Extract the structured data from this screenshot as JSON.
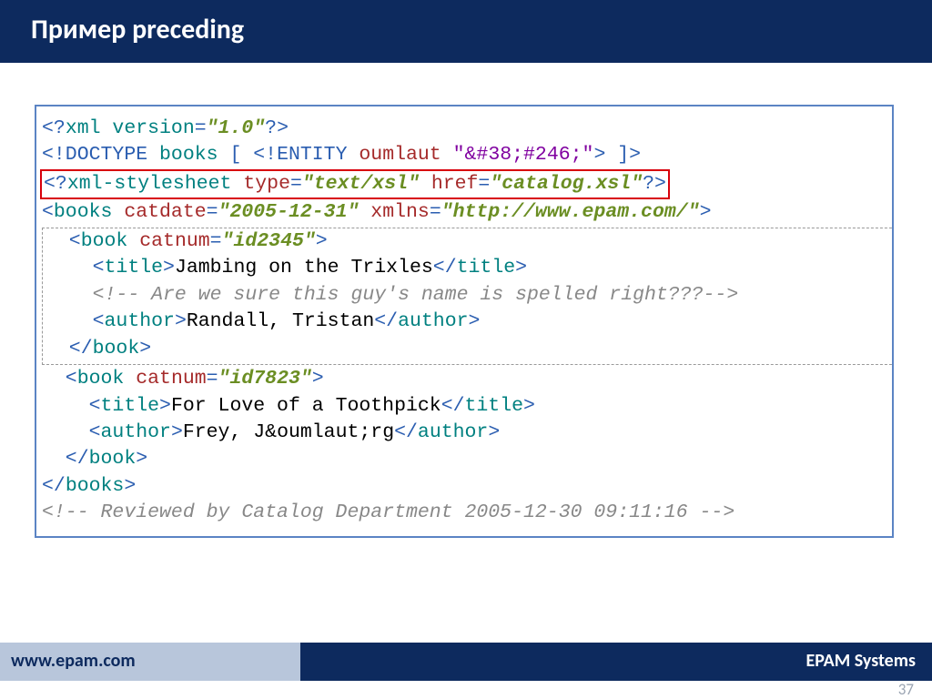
{
  "title": "Пример preceding",
  "code": {
    "l1": {
      "a": "<?",
      "b": "xml version",
      "c": "=",
      "d": "\"1.0\"",
      "e": "?>"
    },
    "l2": {
      "a": "<!DOCTYPE ",
      "b": "books",
      "c": " [ ",
      "d": "<!ENTITY ",
      "e": "oumlaut ",
      "f": "\"&#38;#246;\"",
      "g": "> ",
      "h": "]>"
    },
    "l3": {
      "a": "<?",
      "b": "xml-stylesheet ",
      "c": "type",
      "d": "=",
      "e": "\"text/xsl\" ",
      "f": "href",
      "g": "=",
      "h": "\"catalog.xsl\"",
      "i": "?>"
    },
    "l4": {
      "a": "<",
      "b": "books ",
      "c": "catdate",
      "d": "=",
      "e": "\"2005-12-31\" ",
      "f": "xmlns",
      "g": "=",
      "h": "\"http://www.epam.com/\"",
      "i": ">"
    },
    "l5": {
      "a": "  <",
      "b": "book ",
      "c": "catnum",
      "d": "=",
      "e": "\"id2345\"",
      "f": ">"
    },
    "l6": {
      "a": "    <",
      "b": "title",
      "c": ">",
      "d": "Jambing on the Trixles",
      "e": "</",
      "f": "title",
      "g": ">"
    },
    "l7": {
      "a": "    ",
      "b": "<!-- Are we sure this guy's name is spelled right???-->"
    },
    "l8": {
      "a": "    <",
      "b": "author",
      "c": ">",
      "d": "Randall, Tristan",
      "e": "</",
      "f": "author",
      "g": ">"
    },
    "l9": {
      "a": "  </",
      "b": "book",
      "c": ">"
    },
    "l10": {
      "a": "  <",
      "b": "book ",
      "c": "catnum",
      "d": "=",
      "e": "\"id7823\"",
      "f": ">"
    },
    "l11": {
      "a": "    <",
      "b": "title",
      "c": ">",
      "d": "For Love of a Toothpick",
      "e": "</",
      "f": "title",
      "g": ">"
    },
    "l12": {
      "a": "    <",
      "b": "author",
      "c": ">",
      "d": "Frey, J",
      "e": "&oumlaut;",
      "f": "rg",
      "g": "</",
      "h": "author",
      "i": ">"
    },
    "l13": {
      "a": "  </",
      "b": "book",
      "c": ">"
    },
    "l14": {
      "a": "</",
      "b": "books",
      "c": ">"
    },
    "l15": {
      "a": "<!-- Reviewed by Catalog Department 2005-12-30 09:11:16 -->"
    }
  },
  "footer": {
    "left": "www.epam.com",
    "right": "EPAM Systems"
  },
  "page": "37"
}
